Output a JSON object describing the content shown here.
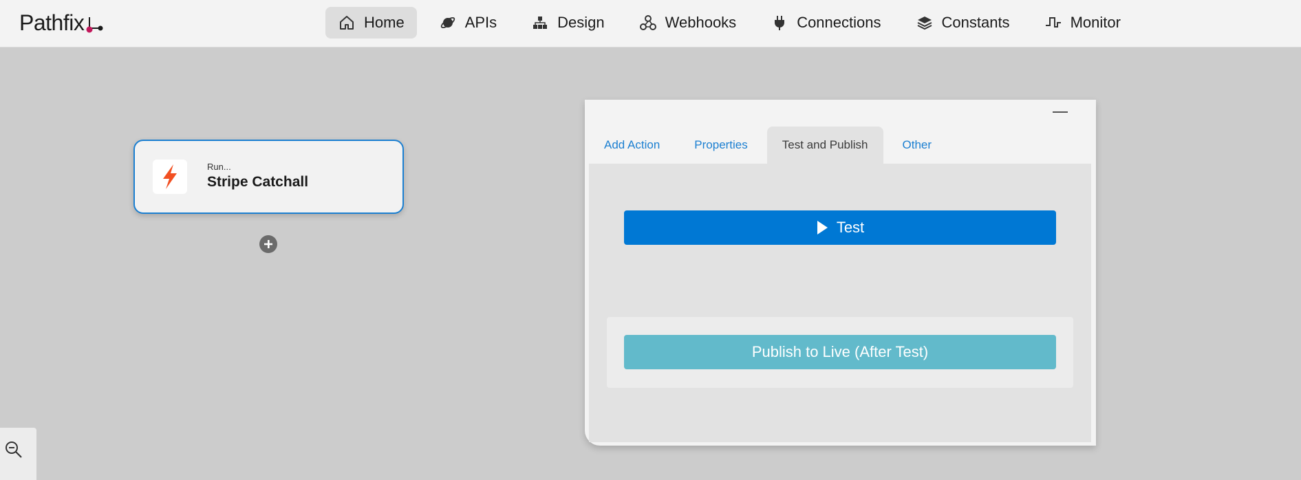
{
  "app": {
    "logo_text": "Pathfix",
    "brand_colors": {
      "accent": "#0078d4",
      "logo_dot": "#c2185b"
    }
  },
  "nav": {
    "items": [
      {
        "label": "Home",
        "icon": "home-icon",
        "active": true
      },
      {
        "label": "APIs",
        "icon": "planet-icon"
      },
      {
        "label": "Design",
        "icon": "hierarchy-icon"
      },
      {
        "label": "Webhooks",
        "icon": "webhook-icon"
      },
      {
        "label": "Connections",
        "icon": "plug-icon"
      },
      {
        "label": "Constants",
        "icon": "layers-icon"
      },
      {
        "label": "Monitor",
        "icon": "pulse-icon"
      }
    ]
  },
  "canvas": {
    "node": {
      "subtitle": "Run...",
      "title": "Stripe Catchall",
      "icon": "lightning-icon",
      "icon_color": "#f25022"
    },
    "add_icon": "plus-circle-icon"
  },
  "panel": {
    "tabs": [
      {
        "label": "Add Action"
      },
      {
        "label": "Properties"
      },
      {
        "label": "Test and Publish",
        "active": true
      },
      {
        "label": "Other"
      }
    ],
    "test_button": {
      "label": "Test",
      "icon": "play-icon"
    },
    "publish_button": {
      "label": "Publish to Live (After Test)"
    }
  },
  "zoom": {
    "icon": "zoom-out-icon"
  }
}
